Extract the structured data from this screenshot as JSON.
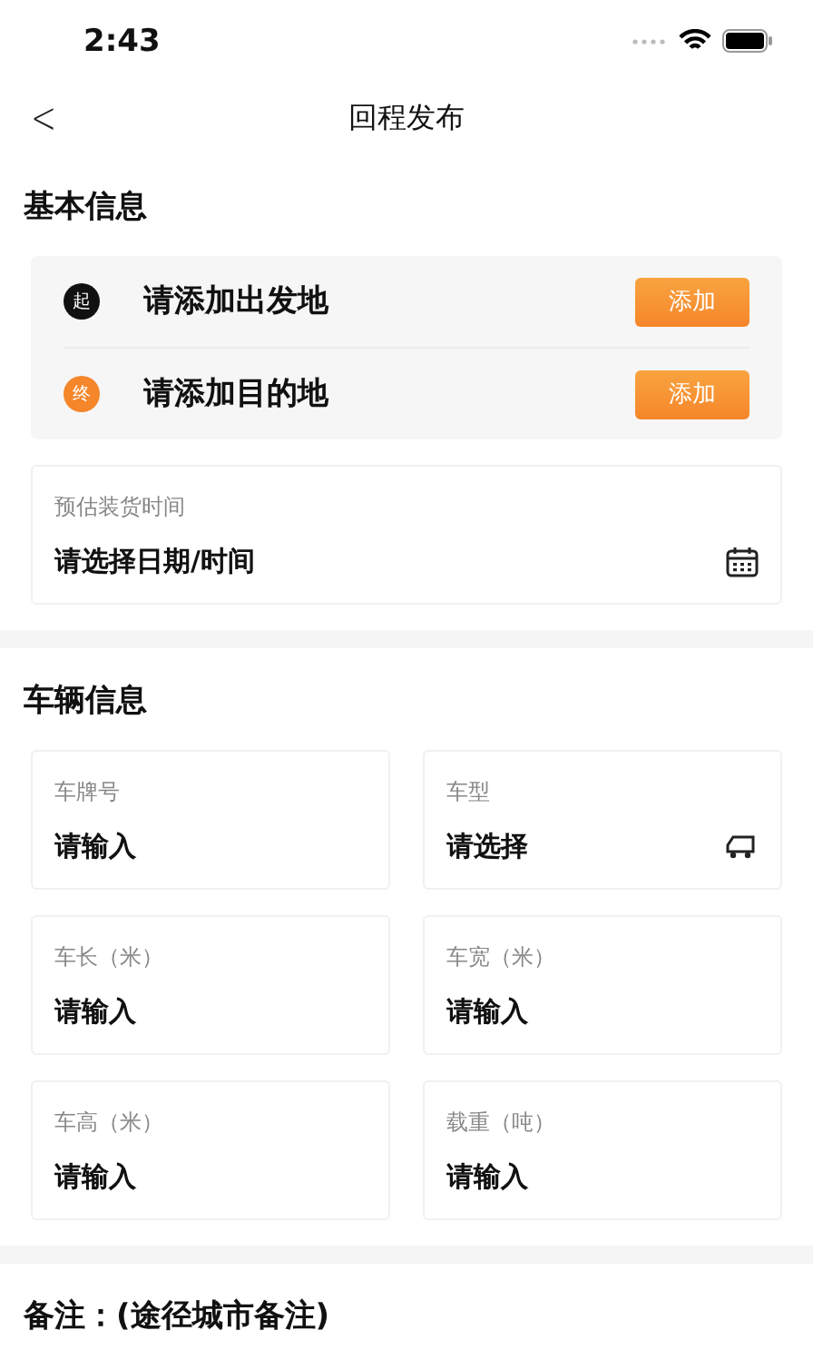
{
  "status_bar": {
    "time": "2:43"
  },
  "nav": {
    "back": "<",
    "title": "回程发布"
  },
  "sections": [
    {
      "title": "基本信息",
      "locations": [
        {
          "marker": "起",
          "color": "#111111",
          "placeholder": "请添加出发地",
          "button": "添加"
        },
        {
          "marker": "终",
          "color": "#f5862a",
          "placeholder": "请添加目的地",
          "button": "添加"
        }
      ],
      "fields": [
        {
          "label": "预估装货时间",
          "placeholder": "请选择日期/时间",
          "kind": "date"
        }
      ]
    },
    {
      "title": "车辆信息",
      "fields": [
        {
          "label": "车牌号",
          "placeholder": "请输入",
          "kind": "text"
        },
        {
          "label": "车型",
          "placeholder": "请选择",
          "kind": "vehicle"
        },
        {
          "label": "车长（米）",
          "placeholder": "请输入",
          "kind": "text"
        },
        {
          "label": "车宽（米）",
          "placeholder": "请输入",
          "kind": "text"
        },
        {
          "label": "车高（米）",
          "placeholder": "请输入",
          "kind": "text"
        },
        {
          "label": "载重（吨）",
          "placeholder": "请输入",
          "kind": "text"
        }
      ]
    },
    {
      "title": "备注：(途径城市备注)"
    }
  ]
}
